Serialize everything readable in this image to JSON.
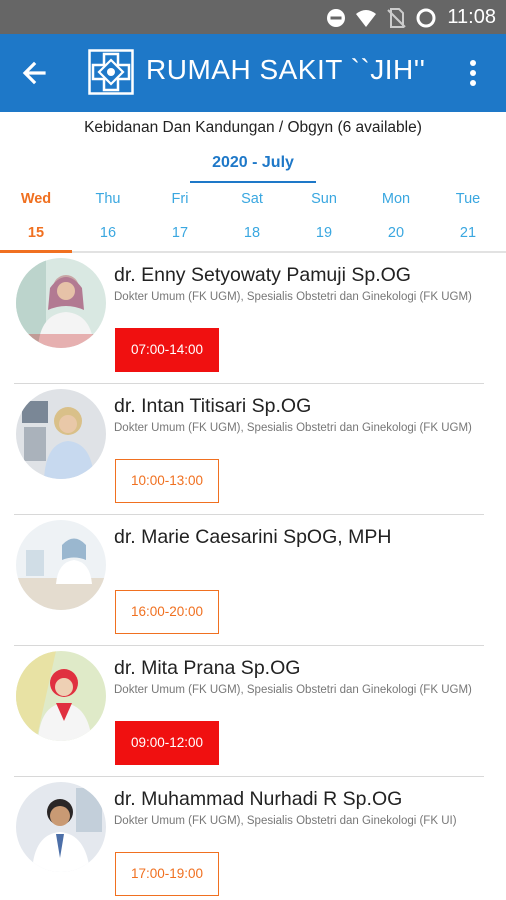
{
  "status_bar": {
    "time": "11:08",
    "icons": [
      "do-not-disturb-icon",
      "wifi-icon",
      "no-sim-icon",
      "battery-icon"
    ]
  },
  "app_bar": {
    "title": "RUMAH SAKIT ``JIH''",
    "back_icon": "arrow-left-icon",
    "menu_icon": "more-vertical-icon",
    "color": "#1e78c8"
  },
  "department": "Kebidanan Dan Kandungan / Obgyn (6 available)",
  "month_label": "2020 - July",
  "days": [
    {
      "name": "Wed",
      "num": "15"
    },
    {
      "name": "Thu",
      "num": "16"
    },
    {
      "name": "Fri",
      "num": "17"
    },
    {
      "name": "Sat",
      "num": "18"
    },
    {
      "name": "Sun",
      "num": "19"
    },
    {
      "name": "Mon",
      "num": "20"
    },
    {
      "name": "Tue",
      "num": "21"
    }
  ],
  "selected_day": "Wed",
  "doctors": [
    {
      "name": "dr. Enny Setyowaty Pamuji Sp.OG",
      "desc": "Dokter Umum (FK UGM), Spesialis Obstetri dan Ginekologi (FK UGM)",
      "time": "07:00-14:00",
      "status": "full"
    },
    {
      "name": "dr. Intan Titisari Sp.OG",
      "desc": "Dokter Umum (FK UGM), Spesialis Obstetri dan Ginekologi (FK UGM)",
      "time": "10:00-13:00",
      "status": "open"
    },
    {
      "name": "dr. Marie Caesarini SpOG, MPH",
      "desc": "",
      "time": "16:00-20:00",
      "status": "open"
    },
    {
      "name": "dr. Mita Prana Sp.OG",
      "desc": "Dokter Umum (FK UGM), Spesialis Obstetri dan Ginekologi (FK UGM)",
      "time": "09:00-12:00",
      "status": "full"
    },
    {
      "name": "dr. Muhammad Nurhadi R Sp.OG",
      "desc": "Dokter Umum (FK UGM), Spesialis Obstetri dan Ginekologi (FK UI)",
      "time": "17:00-19:00",
      "status": "open"
    }
  ],
  "colors": {
    "accent": "#1e78c8",
    "selected_day": "#f07020",
    "day_text": "#3aa7e0",
    "slot_full": "#f01010",
    "slot_open": "#f07020"
  }
}
